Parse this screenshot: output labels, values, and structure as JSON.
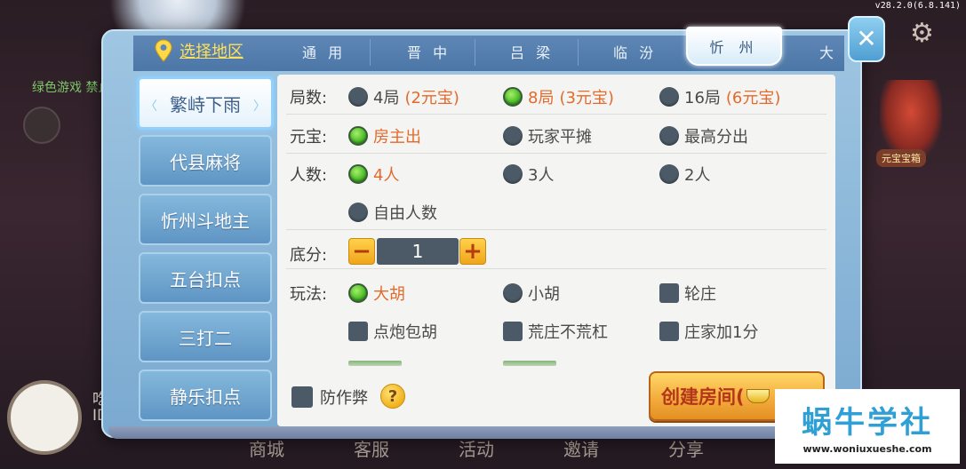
{
  "version": "v28.2.0(6.8.141)",
  "background": {
    "notice_text": "绿色游戏 禁止",
    "user_name": "吃瓜群",
    "user_id": "ID:52",
    "treasure_label": "元宝宝箱",
    "bottom_nav": [
      "商城",
      "客服",
      "活动",
      "邀请",
      "分享"
    ]
  },
  "header": {
    "region_label": "选择地区",
    "tabs": [
      "通 用",
      "晋 中",
      "吕 梁",
      "临 汾",
      "忻 州",
      "大"
    ],
    "active_tab": "忻 州"
  },
  "sidebar": {
    "items": [
      {
        "label": "繁峙下雨",
        "selected": true
      },
      {
        "label": "代县麻将",
        "selected": false
      },
      {
        "label": "忻州斗地主",
        "selected": false
      },
      {
        "label": "五台扣点",
        "selected": false
      },
      {
        "label": "三打二",
        "selected": false
      },
      {
        "label": "静乐扣点",
        "selected": false
      }
    ]
  },
  "options": {
    "rounds": {
      "label": "局数:",
      "choices": [
        {
          "text": "4局",
          "extra": "(2元宝)",
          "selected": false
        },
        {
          "text": "8局",
          "extra": "(3元宝)",
          "selected": true
        },
        {
          "text": "16局",
          "extra": "(6元宝)",
          "selected": false
        }
      ]
    },
    "payment": {
      "label": "元宝:",
      "choices": [
        {
          "text": "房主出",
          "selected": true
        },
        {
          "text": "玩家平摊",
          "selected": false
        },
        {
          "text": "最高分出",
          "selected": false
        }
      ]
    },
    "players": {
      "label": "人数:",
      "choices": [
        {
          "text": "4人",
          "selected": true
        },
        {
          "text": "3人",
          "selected": false
        },
        {
          "text": "2人",
          "selected": false
        },
        {
          "text": "自由人数",
          "selected": false
        }
      ]
    },
    "base_score": {
      "label": "底分:",
      "value": "1"
    },
    "play": {
      "label": "玩法:",
      "choices": [
        {
          "text": "大胡",
          "type": "radio",
          "selected": true
        },
        {
          "text": "小胡",
          "type": "radio",
          "selected": false
        },
        {
          "text": "轮庄",
          "type": "checkbox",
          "selected": false
        },
        {
          "text": "点炮包胡",
          "type": "checkbox",
          "selected": false
        },
        {
          "text": "荒庄不荒杠",
          "type": "checkbox",
          "selected": false
        },
        {
          "text": "庄家加1分",
          "type": "checkbox",
          "selected": false
        }
      ]
    }
  },
  "footer": {
    "anti_cheat_label": "防作弊",
    "help_symbol": "?",
    "create_label": "创建房间("
  },
  "watermark": {
    "title": "蜗牛学社",
    "url": "www.woniuxueshe.com"
  },
  "colors": {
    "accent_orange": "#e26a2c",
    "selected_green": "#4fbf2b",
    "tab_blue": "#4c76a6"
  }
}
